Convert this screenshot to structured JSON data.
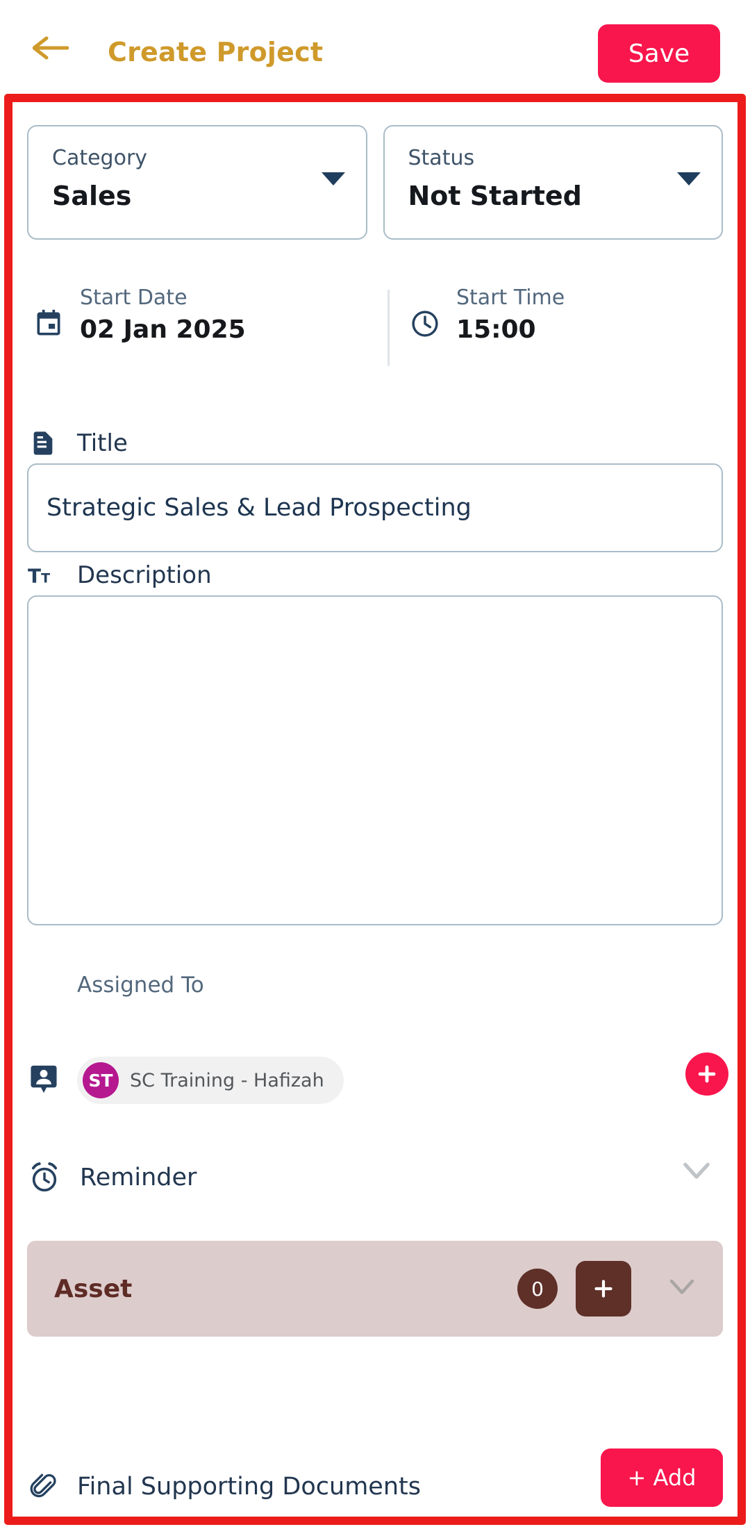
{
  "appbar": {
    "back_icon": "arrow-left-icon",
    "title": "Create Project",
    "save_label": "Save",
    "title_color": "#CF9A2B",
    "save_bg": "#F8164C"
  },
  "highlight": {
    "border_color": "#EC1C1C"
  },
  "form": {
    "category": {
      "label": "Category",
      "value": "Sales",
      "caret_icon": "caret-down-icon"
    },
    "status": {
      "label": "Status",
      "value": "Not Started",
      "caret_icon": "caret-down-icon"
    },
    "start_date": {
      "label": "Start Date",
      "value": "02 Jan 2025",
      "icon": "calendar-icon"
    },
    "start_time": {
      "label": "Start Time",
      "value": "15:00",
      "icon": "clock-icon"
    },
    "title": {
      "label": "Title",
      "icon": "document-icon",
      "value": "Strategic Sales & Lead Prospecting",
      "placeholder": ""
    },
    "description": {
      "label": "Description",
      "icon": "text-format-icon",
      "value": "",
      "placeholder": ""
    },
    "assigned_to": {
      "label": "Assigned To",
      "icon": "account-box-icon",
      "add_icon": "plus-icon",
      "add_color": "#F8164C",
      "chips": [
        {
          "initials": "ST",
          "name": "SC Training - Hafizah",
          "avatar_color": "#B5188F"
        }
      ]
    },
    "reminder": {
      "label": "Reminder",
      "icon": "alarm-clock-icon",
      "chevron_icon": "chevron-down-icon"
    },
    "asset": {
      "label": "Asset",
      "count": "0",
      "add_icon": "plus-icon",
      "chevron_icon": "chevron-down-icon",
      "bar_color": "#DDCCCC",
      "accent_color": "#5E3028"
    },
    "final_documents": {
      "label": "Final Supporting Documents",
      "icon": "paperclip-icon",
      "add_label": "+ Add",
      "add_color": "#F8164C"
    }
  }
}
